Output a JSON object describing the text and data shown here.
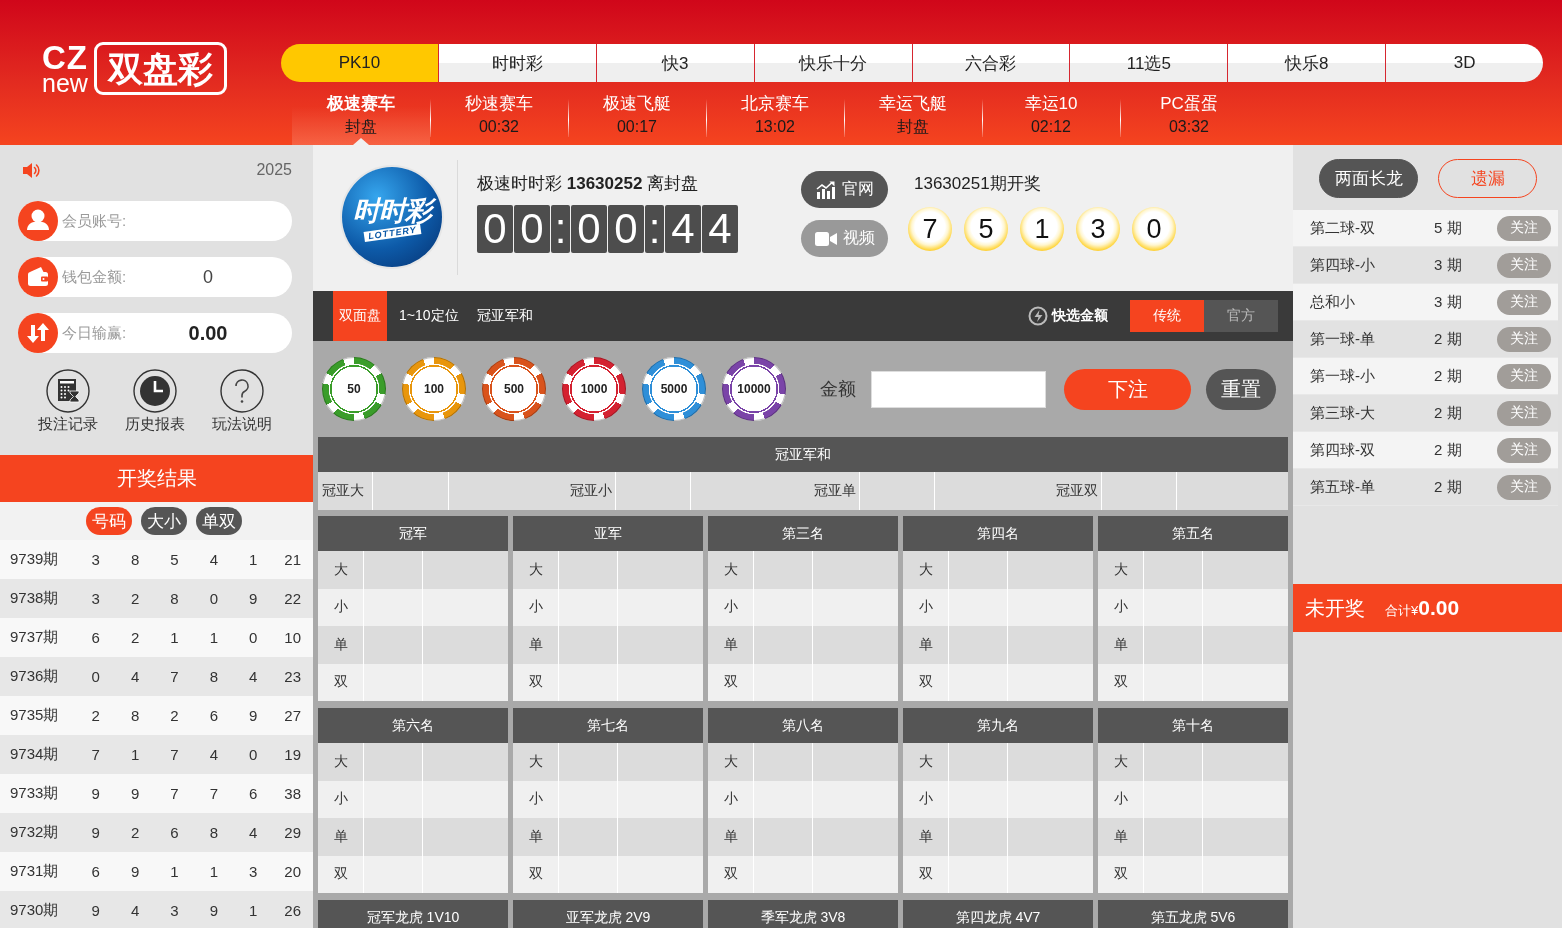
{
  "header": {
    "logo": {
      "mark_top": "CZ",
      "mark_bottom": "new",
      "name": "双盘彩"
    },
    "categories": [
      {
        "label": "PK10",
        "selected": true
      },
      {
        "label": "时时彩",
        "selected": false
      },
      {
        "label": "快3",
        "selected": false
      },
      {
        "label": "快乐十分",
        "selected": false
      },
      {
        "label": "六合彩",
        "selected": false
      },
      {
        "label": "11选5",
        "selected": false
      },
      {
        "label": "快乐8",
        "selected": false
      },
      {
        "label": "3D",
        "selected": false
      }
    ],
    "games": [
      {
        "name": "极速赛车",
        "status": "封盘",
        "selected": true
      },
      {
        "name": "秒速赛车",
        "status": "00:32",
        "selected": false
      },
      {
        "name": "极速飞艇",
        "status": "00:17",
        "selected": false
      },
      {
        "name": "北京赛车",
        "status": "13:02",
        "selected": false
      },
      {
        "name": "幸运飞艇",
        "status": "封盘",
        "selected": false
      },
      {
        "name": "幸运10",
        "status": "02:12",
        "selected": false
      },
      {
        "name": "PC蛋蛋",
        "status": "03:32",
        "selected": false
      }
    ]
  },
  "account": {
    "year": "2025",
    "fields": [
      {
        "kind": "member",
        "label": "会员账号:"
      },
      {
        "kind": "wallet",
        "label": "钱包金额:",
        "value": "0"
      },
      {
        "kind": "profit",
        "label": "今日输赢:",
        "value": "0.00"
      }
    ],
    "links": [
      {
        "kind": "records",
        "label": "投注记录"
      },
      {
        "kind": "history",
        "label": "历史报表"
      },
      {
        "kind": "rules",
        "label": "玩法说明"
      }
    ]
  },
  "results": {
    "title": "开奖结果",
    "views": [
      {
        "label": "号码",
        "selected": true
      },
      {
        "label": "大小",
        "selected": false
      },
      {
        "label": "单双",
        "selected": false
      }
    ],
    "rows": [
      {
        "period": "9739期",
        "numbers": [
          "3",
          "8",
          "5",
          "4",
          "1"
        ],
        "sum": "21"
      },
      {
        "period": "9738期",
        "numbers": [
          "3",
          "2",
          "8",
          "0",
          "9"
        ],
        "sum": "22"
      },
      {
        "period": "9737期",
        "numbers": [
          "6",
          "2",
          "1",
          "1",
          "0"
        ],
        "sum": "10"
      },
      {
        "period": "9736期",
        "numbers": [
          "0",
          "4",
          "7",
          "8",
          "4"
        ],
        "sum": "23"
      },
      {
        "period": "9735期",
        "numbers": [
          "2",
          "8",
          "2",
          "6",
          "9"
        ],
        "sum": "27"
      },
      {
        "period": "9734期",
        "numbers": [
          "7",
          "1",
          "7",
          "4",
          "0"
        ],
        "sum": "19"
      },
      {
        "period": "9733期",
        "numbers": [
          "9",
          "9",
          "7",
          "7",
          "6"
        ],
        "sum": "38"
      },
      {
        "period": "9732期",
        "numbers": [
          "9",
          "2",
          "6",
          "8",
          "4"
        ],
        "sum": "29"
      },
      {
        "period": "9731期",
        "numbers": [
          "6",
          "9",
          "1",
          "1",
          "3"
        ],
        "sum": "20"
      },
      {
        "period": "9730期",
        "numbers": [
          "9",
          "4",
          "3",
          "9",
          "1"
        ],
        "sum": "26"
      }
    ]
  },
  "draw": {
    "logo": {
      "name": "时时彩",
      "subtitle": "LOTTERY"
    },
    "heading": "极速时时彩 **13630252** 离封盘",
    "countdown": {
      "groups": [
        [
          "0",
          "0"
        ],
        [
          "0",
          "0"
        ],
        [
          "4",
          "4"
        ]
      ],
      "separator": ":"
    },
    "buttons": [
      {
        "kind": "website",
        "label": "官网",
        "disabled": false
      },
      {
        "kind": "video",
        "label": "视频",
        "disabled": true
      }
    ],
    "last_draw": "13630251期开奖",
    "balls": [
      "7",
      "5",
      "1",
      "3",
      "0"
    ]
  },
  "betting": {
    "tabs": [
      {
        "label": "双面盘",
        "selected": true
      },
      {
        "label": "1~10定位",
        "selected": false
      },
      {
        "label": "冠亚军和",
        "selected": false
      }
    ],
    "quick_amount": "快选金额",
    "modes": [
      {
        "label": "传统",
        "selected": true
      },
      {
        "label": "官方",
        "selected": false
      }
    ],
    "chips": [
      {
        "value": "50",
        "color": "#3a9d2a"
      },
      {
        "value": "100",
        "color": "#e8960c"
      },
      {
        "value": "500",
        "color": "#d9531c"
      },
      {
        "value": "1000",
        "color": "#d42231"
      },
      {
        "value": "5000",
        "color": "#2f8fd8"
      },
      {
        "value": "10000",
        "color": "#7a44a8"
      }
    ],
    "amount_label": "金额",
    "submit": "下注",
    "reset": "重置"
  },
  "tables": {
    "sum": {
      "title": "冠亚军和",
      "options": [
        "冠亚大",
        "冠亚小",
        "冠亚单",
        "冠亚双"
      ]
    },
    "positions": [
      {
        "title": "冠军",
        "options": [
          "大",
          "小",
          "单",
          "双"
        ]
      },
      {
        "title": "亚军",
        "options": [
          "大",
          "小",
          "单",
          "双"
        ]
      },
      {
        "title": "第三名",
        "options": [
          "大",
          "小",
          "单",
          "双"
        ]
      },
      {
        "title": "第四名",
        "options": [
          "大",
          "小",
          "单",
          "双"
        ]
      },
      {
        "title": "第五名",
        "options": [
          "大",
          "小",
          "单",
          "双"
        ]
      },
      {
        "title": "第六名",
        "options": [
          "大",
          "小",
          "单",
          "双"
        ]
      },
      {
        "title": "第七名",
        "options": [
          "大",
          "小",
          "单",
          "双"
        ]
      },
      {
        "title": "第八名",
        "options": [
          "大",
          "小",
          "单",
          "双"
        ]
      },
      {
        "title": "第九名",
        "options": [
          "大",
          "小",
          "单",
          "双"
        ]
      },
      {
        "title": "第十名",
        "options": [
          "大",
          "小",
          "单",
          "双"
        ]
      }
    ],
    "dragon_tiger": [
      "冠军龙虎 1V10",
      "亚军龙虎 2V9",
      "季军龙虎 3V8",
      "第四龙虎 4V7",
      "第五龙虎 5V6"
    ]
  },
  "long_dragon": {
    "tabs": [
      {
        "label": "两面长龙",
        "selected": true
      },
      {
        "label": "遗漏",
        "selected": false
      }
    ],
    "rows": [
      {
        "name": "第二球-双",
        "streak": "5 期",
        "action": "关注"
      },
      {
        "name": "第四球-小",
        "streak": "3 期",
        "action": "关注"
      },
      {
        "name": "总和小",
        "streak": "3 期",
        "action": "关注"
      },
      {
        "name": "第一球-单",
        "streak": "2 期",
        "action": "关注"
      },
      {
        "name": "第一球-小",
        "streak": "2 期",
        "action": "关注"
      },
      {
        "name": "第三球-大",
        "streak": "2 期",
        "action": "关注"
      },
      {
        "name": "第四球-双",
        "streak": "2 期",
        "action": "关注"
      },
      {
        "name": "第五球-单",
        "streak": "2 期",
        "action": "关注"
      }
    ],
    "status": "未开奖",
    "total": "合计¥**0.00**"
  }
}
